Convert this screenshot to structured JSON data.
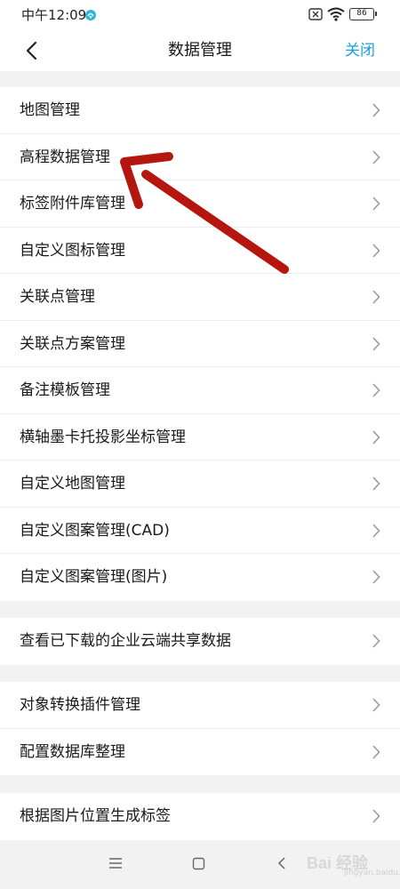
{
  "status_bar": {
    "time": "中午12:09",
    "battery": "86",
    "icons": [
      "app-notification-icon",
      "sim-icon",
      "wifi-icon",
      "battery-icon"
    ]
  },
  "header": {
    "title": "数据管理",
    "close_label": "关闭",
    "back_icon": "chevron-left-icon",
    "accent_color": "#1aa0e0"
  },
  "groups": [
    {
      "items": [
        {
          "label": "地图管理"
        },
        {
          "label": "高程数据管理"
        },
        {
          "label": "标签附件库管理"
        },
        {
          "label": "自定义图标管理"
        },
        {
          "label": "关联点管理"
        },
        {
          "label": "关联点方案管理"
        },
        {
          "label": "备注模板管理"
        },
        {
          "label": "横轴墨卡托投影坐标管理"
        },
        {
          "label": "自定义地图管理"
        },
        {
          "label": "自定义图案管理(CAD)"
        },
        {
          "label": "自定义图案管理(图片)"
        }
      ]
    },
    {
      "items": [
        {
          "label": "查看已下载的企业云端共享数据"
        }
      ]
    },
    {
      "items": [
        {
          "label": "对象转换插件管理"
        },
        {
          "label": "配置数据库整理"
        }
      ]
    },
    {
      "items": [
        {
          "label": "根据图片位置生成标签"
        }
      ]
    }
  ],
  "annotation": {
    "arrow_color": "#b5160e"
  },
  "nav_bar": {
    "icons": [
      "menu-icon",
      "home-icon",
      "back-icon"
    ],
    "watermark": "Bai 经验",
    "watermark_sub": "jingyan.baidu.com"
  }
}
